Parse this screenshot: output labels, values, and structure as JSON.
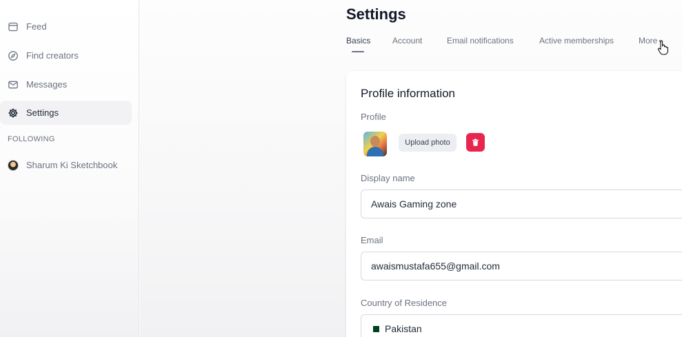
{
  "sidebar": {
    "items": [
      {
        "label": "Feed",
        "icon": "feed-icon"
      },
      {
        "label": "Find creators",
        "icon": "compass-icon"
      },
      {
        "label": "Messages",
        "icon": "mail-icon"
      },
      {
        "label": "Settings",
        "icon": "gear-icon",
        "active": true
      }
    ],
    "following_label": "FOLLOWING",
    "following": [
      {
        "label": "Sharum Ki Sketchbook",
        "icon": "avatar"
      }
    ]
  },
  "header": {
    "title": "Settings"
  },
  "tabs": [
    {
      "label": "Basics",
      "active": true
    },
    {
      "label": "Account"
    },
    {
      "label": "Email notifications"
    },
    {
      "label": "Active memberships"
    },
    {
      "label": "More"
    }
  ],
  "profile_card": {
    "title": "Profile information",
    "profile_label": "Profile",
    "upload_label": "Upload photo",
    "display_name_label": "Display name",
    "display_name_value": "Awais Gaming zone",
    "email_label": "Email",
    "email_value": "awaismustafa655@gmail.com",
    "country_label": "Country of Residence",
    "country_value": "Pakistan"
  },
  "colors": {
    "delete": "#e8254f",
    "active_tab": "#374151",
    "page_background": "#f7f7f8"
  }
}
